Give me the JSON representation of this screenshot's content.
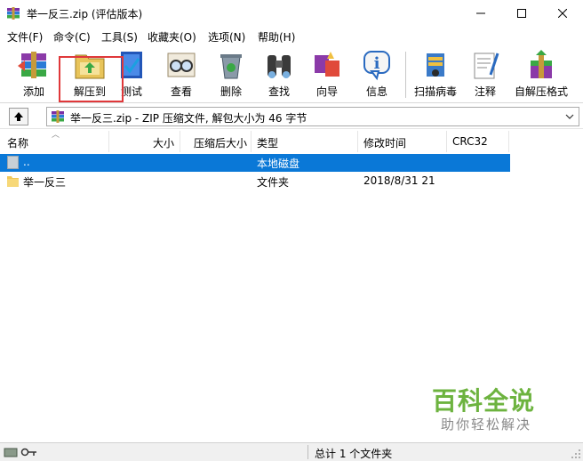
{
  "window": {
    "title": "举一反三.zip (评估版本)",
    "controls": {
      "minimize": "—",
      "maximize": "☐",
      "close": "✕"
    }
  },
  "menu": [
    {
      "label": "文件(F)"
    },
    {
      "label": "命令(C)"
    },
    {
      "label": "工具(S)"
    },
    {
      "label": "收藏夹(O)"
    },
    {
      "label": "选项(N)"
    },
    {
      "label": "帮助(H)"
    }
  ],
  "toolbar": [
    {
      "label": "添加",
      "icon": "add-books-icon"
    },
    {
      "label": "解压到",
      "icon": "extract-folder-icon"
    },
    {
      "label": "测试",
      "icon": "test-book-icon"
    },
    {
      "label": "查看",
      "icon": "view-glasses-icon"
    },
    {
      "label": "删除",
      "icon": "delete-recycle-icon"
    },
    {
      "label": "查找",
      "icon": "find-binoculars-icon"
    },
    {
      "label": "向导",
      "icon": "wizard-icon"
    },
    {
      "label": "信息",
      "icon": "info-icon"
    },
    {
      "label": "扫描病毒",
      "icon": "scan-virus-icon"
    },
    {
      "label": "注释",
      "icon": "comment-icon"
    },
    {
      "label": "自解压格式",
      "icon": "sfx-icon"
    }
  ],
  "address": {
    "path": "举一反三.zip - ZIP 压缩文件, 解包大小为 46 字节"
  },
  "columns": [
    {
      "label": "名称"
    },
    {
      "label": "大小"
    },
    {
      "label": "压缩后大小"
    },
    {
      "label": "类型"
    },
    {
      "label": "修改时间"
    },
    {
      "label": "CRC32"
    }
  ],
  "rows": [
    {
      "name": "..",
      "size": "",
      "packed": "",
      "type": "本地磁盘",
      "modified": "",
      "crc": "",
      "selected": true
    },
    {
      "name": "举一反三",
      "size": "",
      "packed": "",
      "type": "文件夹",
      "modified": "2018/8/31 21",
      "crc": "",
      "selected": false
    }
  ],
  "status": {
    "summary": "总计 1 个文件夹"
  },
  "watermark": {
    "main": "百科全说",
    "sub": "助你轻松解决"
  },
  "colors": {
    "selection": "#0a78d7",
    "highlight_box": "#e0383a",
    "watermark_green": "#6db33f"
  }
}
